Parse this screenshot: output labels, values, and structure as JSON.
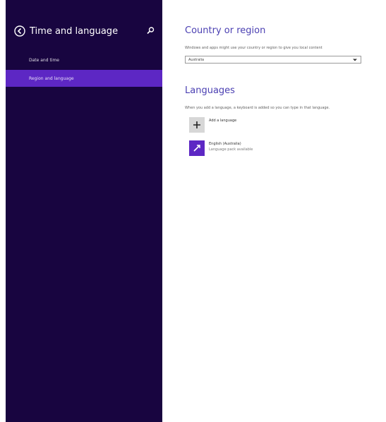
{
  "sidebar": {
    "title": "Time and language",
    "items": [
      {
        "label": "Date and time"
      },
      {
        "label": "Region and language"
      }
    ],
    "active_index": 1
  },
  "content": {
    "country_region": {
      "title": "Country or region",
      "description": "Windows and apps might use your country or region to give you local content",
      "selected": "Australia"
    },
    "languages": {
      "title": "Languages",
      "description": "When you add a language, a keyboard is added so you can type in that language.",
      "add_label": "Add a language",
      "installed": [
        {
          "name": "English (Australia)",
          "status": "Language pack available"
        }
      ]
    }
  },
  "colors": {
    "sidebar_bg": "#180540",
    "accent": "#5d27c4",
    "heading": "#4a3fb2"
  },
  "icons": {
    "back": "back-icon",
    "search": "search-icon",
    "dropdown": "chevron-down-icon",
    "add": "plus-icon",
    "language": "language-icon"
  }
}
